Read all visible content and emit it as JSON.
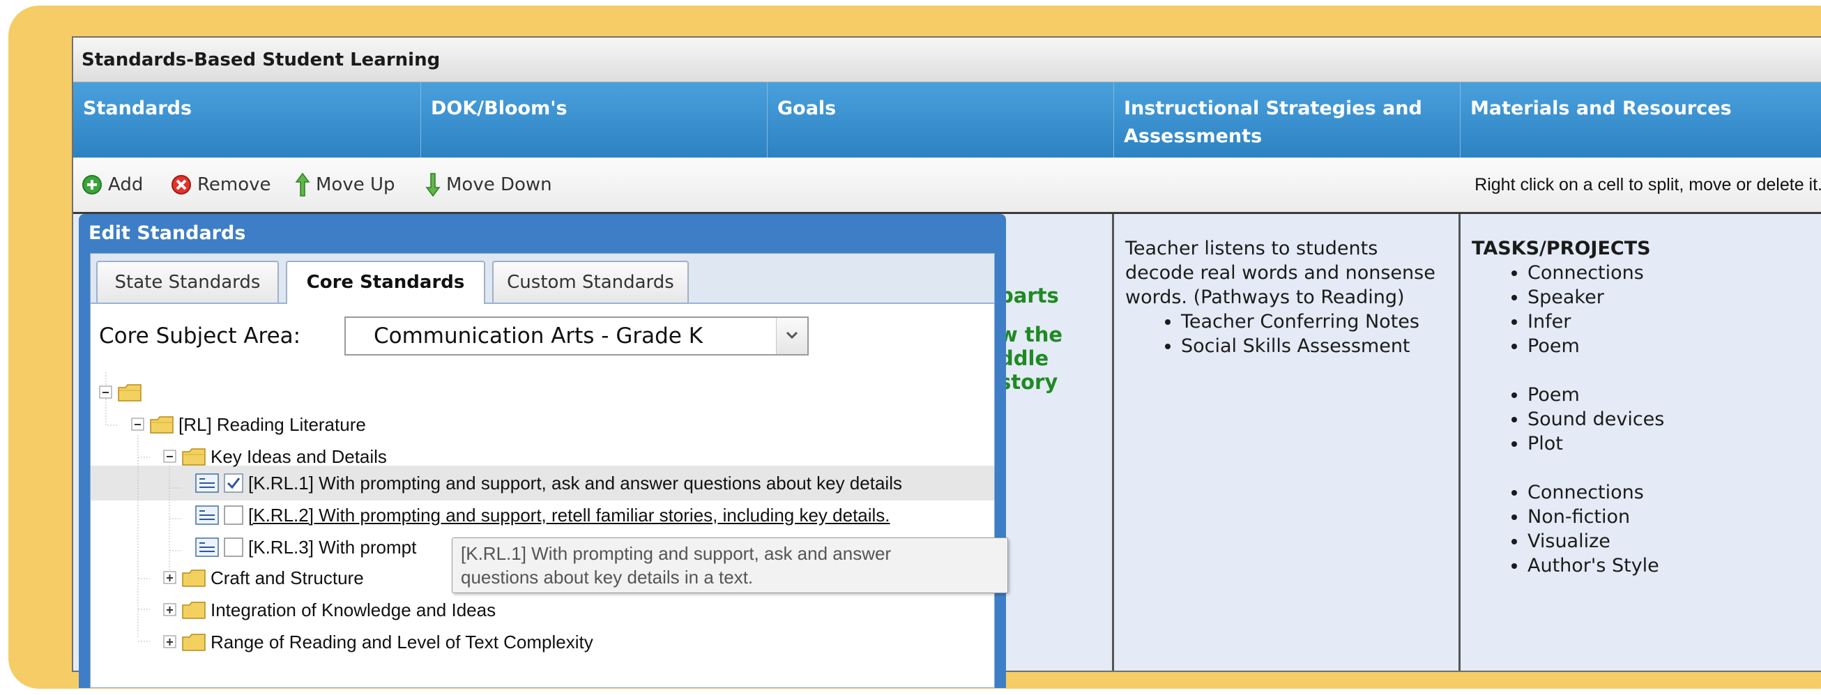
{
  "app": {
    "title": "Standards-Based Student Learning",
    "columns": [
      "Standards",
      "DOK/Bloom's",
      "Goals",
      "Instructional Strategies and Assessments",
      "Materials and Resources"
    ]
  },
  "toolbar": {
    "add_label": "Add",
    "remove_label": "Remove",
    "move_up_label": "Move Up",
    "move_down_label": "Move Down",
    "hint": "Right click on a cell to split, move or delete it."
  },
  "goals_fragments": [
    "parts",
    "w the",
    "ddle",
    "story"
  ],
  "instructional": {
    "text": "Teacher listens to students decode real words and nonsense words. (Pathways to Reading)",
    "items": [
      "Teacher Conferring Notes",
      "Social Skills Assessment"
    ]
  },
  "materials": {
    "heading": "TASKS/PROJECTS",
    "groups": [
      [
        "Connections",
        "Speaker",
        "Infer",
        "Poem"
      ],
      [
        "Poem",
        "Sound devices",
        "Plot"
      ],
      [
        "Connections",
        "Non-fiction",
        "Visualize",
        "Author's Style"
      ]
    ]
  },
  "dialog": {
    "title": "Edit Standards",
    "tabs": [
      "State Standards",
      "Core Standards",
      "Custom Standards"
    ],
    "active_tab": "Core Standards",
    "subject_label": "Core Subject Area:",
    "subject_value": "Communication Arts - Grade K",
    "tree": {
      "root_label": "",
      "reading_literature": "[RL] Reading Literature",
      "key_ideas": "Key Ideas and Details",
      "standards": [
        {
          "code": "[K.RL.1] With prompting and support, ask and answer questions about key details",
          "checked": true
        },
        {
          "code": "[K.RL.2] With prompting and support, retell familiar stories, including key details.",
          "checked": false
        },
        {
          "code": "[K.RL.3] With prompt",
          "checked": false
        }
      ],
      "craft": "Craft and Structure",
      "integration": "Integration of Knowledge and Ideas",
      "range": "Range of Reading and Level of Text Complexity"
    },
    "tooltip_line1": "[K.RL.1] With prompting and support, ask and answer",
    "tooltip_line2": "questions about key details in a text."
  },
  "colors": {
    "accent": "#2d82c2",
    "frame": "#f6cc66",
    "goal_text": "#1f8a22"
  },
  "icons": [
    "add-icon",
    "remove-icon",
    "move-up-icon",
    "move-down-icon",
    "folder-icon",
    "expand-icon",
    "collapse-icon",
    "standard-icon",
    "checkbox-icon",
    "dropdown-arrow-icon"
  ]
}
